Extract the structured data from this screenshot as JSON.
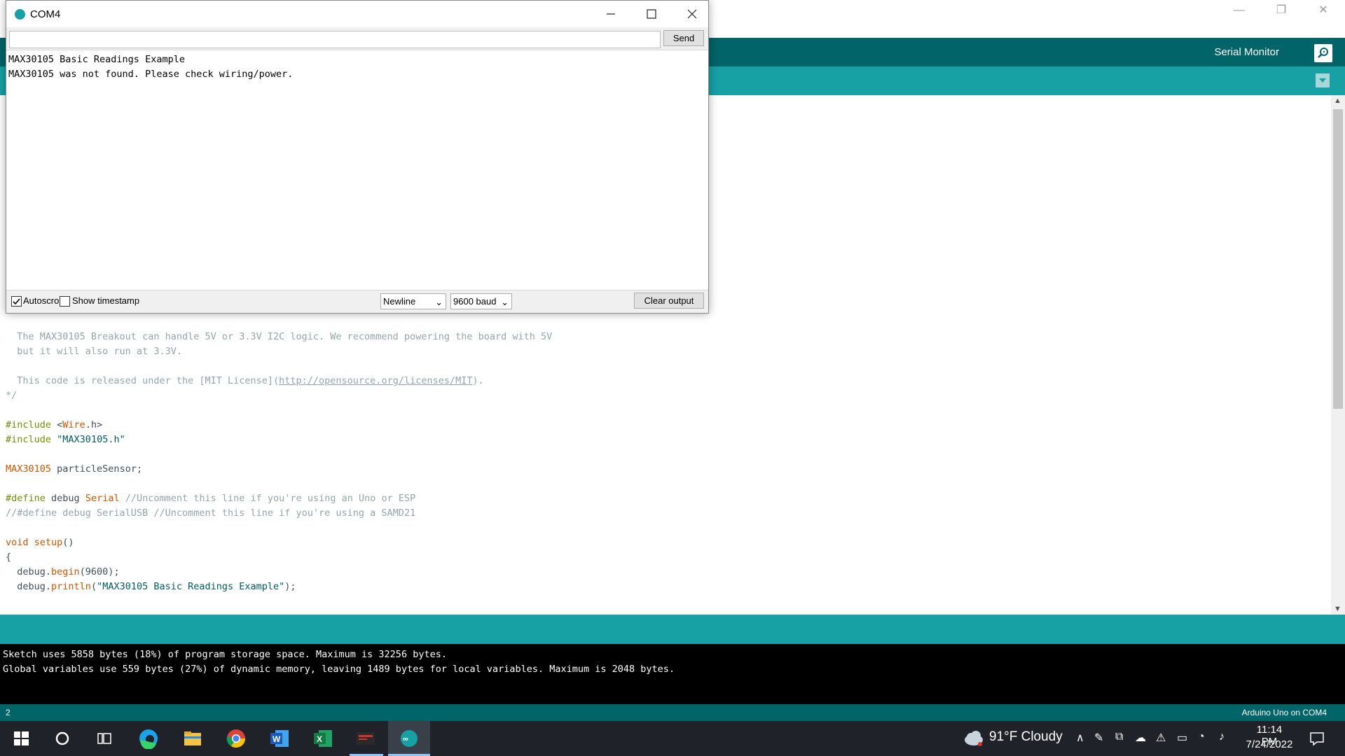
{
  "ide": {
    "toolbar": {
      "serial_monitor_label": "Serial Monitor"
    },
    "code_lines": [
      {
        "text": "  The MAX30105 Breakout can handle 5V or 3.3V I2C logic. We recommend powering the board with 5V",
        "kind": "comment"
      },
      {
        "text": "  but it will also run at 3.3V.",
        "kind": "comment"
      },
      {
        "text": "",
        "kind": "plain"
      },
      {
        "text": "  This code is released under the [MIT License](",
        "kind": "comment",
        "link": "http://opensource.org/licenses/MIT",
        "after": ")."
      },
      {
        "text": "*/",
        "kind": "comment"
      },
      {
        "text": "",
        "kind": "plain"
      },
      {
        "text": "#include <Wire.h>",
        "kind": "include1"
      },
      {
        "text": "#include \"MAX30105.h\"",
        "kind": "include2"
      },
      {
        "text": "",
        "kind": "plain"
      },
      {
        "text": "MAX30105 particleSensor;",
        "kind": "decl"
      },
      {
        "text": "",
        "kind": "plain"
      },
      {
        "text": "#define debug Serial //Uncomment this line if you're using an Uno or ESP",
        "kind": "define1"
      },
      {
        "text": "//#define debug SerialUSB //Uncomment this line if you're using a SAMD21",
        "kind": "comment"
      },
      {
        "text": "",
        "kind": "plain"
      },
      {
        "text": "void setup()",
        "kind": "setup"
      },
      {
        "text": "{",
        "kind": "plain"
      },
      {
        "text": "  debug.begin(9600);",
        "kind": "begin"
      },
      {
        "text": "  debug.println(\"MAX30105 Basic Readings Example\");",
        "kind": "println"
      }
    ],
    "console_lines": [
      "Sketch uses 5858 bytes (18%) of program storage space. Maximum is 32256 bytes.",
      "Global variables use 559 bytes (27%) of dynamic memory, leaving 1489 bytes for local variables. Maximum is 2048 bytes."
    ],
    "footer": {
      "line_number": "2",
      "board": "Arduino Uno on COM4"
    }
  },
  "serial_monitor": {
    "title": "COM4",
    "input_value": "",
    "send_label": "Send",
    "output_lines": [
      "MAX30105 Basic Readings Example",
      "MAX30105 was not found. Please check wiring/power."
    ],
    "autoscroll_label": "Autoscroll",
    "autoscroll_checked": true,
    "timestamp_label": "Show timestamp",
    "timestamp_checked": false,
    "line_ending": "Newline",
    "baud": "9600 baud",
    "clear_label": "Clear output"
  },
  "taskbar": {
    "weather": "91°F  Cloudy",
    "time": "11:14 PM",
    "date": "7/24/2022",
    "apps": [
      "start-icon",
      "search-icon",
      "task-view-icon",
      "edge-icon",
      "file-explorer-icon",
      "chrome-icon",
      "word-icon",
      "excel-icon",
      "project-icon",
      "arduino-icon"
    ]
  },
  "colors": {
    "teal_dark": "#006468",
    "teal": "#17a1a5",
    "taskbar": "#1f2329"
  }
}
